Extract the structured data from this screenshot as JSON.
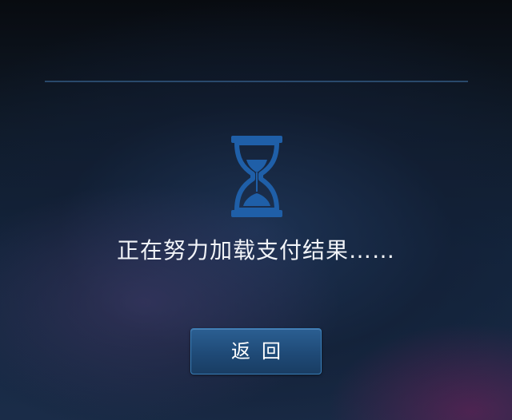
{
  "status": {
    "message": "正在努力加载支付结果……",
    "icon": "hourglass-icon"
  },
  "actions": {
    "back_label": "返回"
  },
  "colors": {
    "accent": "#1f5fa8",
    "button_bg": "#1f4a77",
    "button_border": "#3a7fb8",
    "divider": "#2c4f73",
    "text": "#f2f4f8"
  }
}
